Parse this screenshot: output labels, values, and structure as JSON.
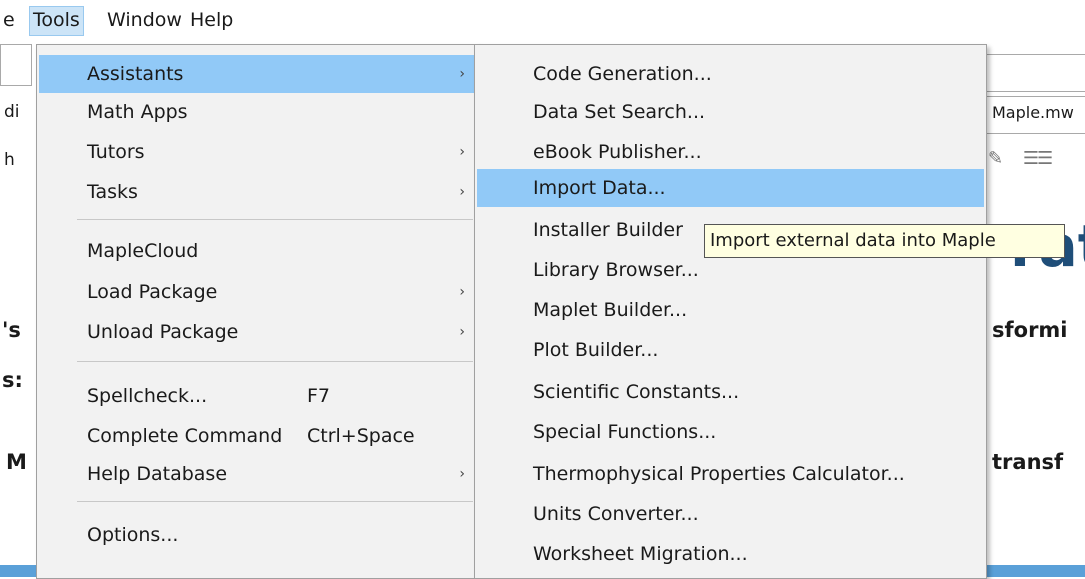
{
  "menubar": {
    "items": [
      {
        "label": "e"
      },
      {
        "label": "Tools"
      },
      {
        "label": "Window"
      },
      {
        "label": "Help"
      }
    ]
  },
  "background": {
    "partial_labels": [
      "di",
      "h",
      "'s",
      "s:",
      "M"
    ],
    "tab_label": "Maple.mw",
    "title_fragment": "rat",
    "line1_fragment": "sformi",
    "line2_fragment": "transf"
  },
  "tools_menu": {
    "items": [
      {
        "label": "Assistants",
        "submenu": true
      },
      {
        "label": "Math Apps",
        "submenu": false
      },
      {
        "label": "Tutors",
        "submenu": true
      },
      {
        "label": "Tasks",
        "submenu": true
      },
      {
        "label": "MapleCloud",
        "submenu": false
      },
      {
        "label": "Load Package",
        "submenu": true
      },
      {
        "label": "Unload Package",
        "submenu": true
      },
      {
        "label": "Spellcheck...",
        "shortcut": "F7"
      },
      {
        "label": "Complete Command",
        "shortcut": "Ctrl+Space"
      },
      {
        "label": "Help Database",
        "submenu": true
      },
      {
        "label": "Options..."
      }
    ],
    "arrow_glyph": "›"
  },
  "assistants_menu": {
    "items": [
      {
        "label": "Code Generation..."
      },
      {
        "label": "Data Set Search..."
      },
      {
        "label": "eBook Publisher..."
      },
      {
        "label": "Import Data..."
      },
      {
        "label": "Installer Builder"
      },
      {
        "label": "Library Browser..."
      },
      {
        "label": "Maplet Builder..."
      },
      {
        "label": "Plot Builder..."
      },
      {
        "label": "Scientific Constants..."
      },
      {
        "label": "Special Functions..."
      },
      {
        "label": "Thermophysical Properties Calculator..."
      },
      {
        "label": "Units Converter..."
      },
      {
        "label": "Worksheet Migration..."
      }
    ]
  },
  "tooltip": {
    "text": "Import external data into Maple"
  }
}
